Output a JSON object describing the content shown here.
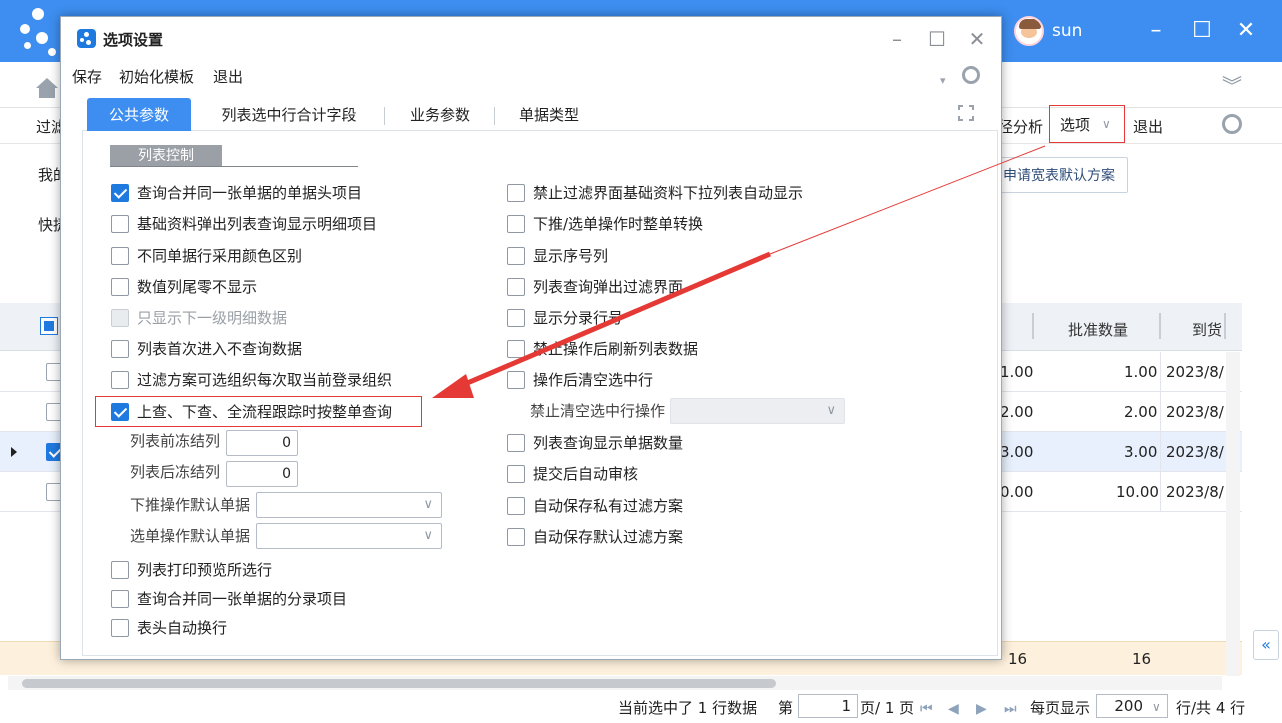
{
  "app": {
    "user_name": "sun",
    "colors": {
      "header": "#3d8ef0",
      "accent": "#1f7ae0",
      "highlight": "#e53935"
    }
  },
  "toolbar": {
    "filter_label": "过滤",
    "analysis_label": "径分析",
    "options_label": "选项",
    "exit_label": "退出"
  },
  "filter_area": {
    "my_label": "我的",
    "quick_label": "快捷",
    "scheme_button": "申请宽表默认方案"
  },
  "grid": {
    "columns": [
      "批准数量",
      "到货"
    ],
    "rows": [
      {
        "checked": false,
        "selected": false,
        "c1": "1.00",
        "c2": "1.00",
        "c3": "2023/8/"
      },
      {
        "checked": false,
        "selected": false,
        "c1": "2.00",
        "c2": "2.00",
        "c3": "2023/8/"
      },
      {
        "checked": true,
        "selected": true,
        "c1": "3.00",
        "c2": "3.00",
        "c3": "2023/8/"
      },
      {
        "checked": false,
        "selected": false,
        "c1": "0.00",
        "c2": "10.00",
        "c3": "2023/8/"
      }
    ],
    "summary": {
      "c1": "16",
      "c2": "16"
    }
  },
  "footer": {
    "selected_info": "当前选中了 1 行数据",
    "page_prefix": "第",
    "page_value": "1",
    "page_suffix": "页/ 1 页",
    "per_page_label": "每页显示",
    "per_page_value": "200",
    "rows_total": "行/共 4 行"
  },
  "dialog": {
    "title": "选项设置",
    "menu": [
      "保存",
      "初始化模板",
      "退出"
    ],
    "tabs": [
      "公共参数",
      "列表选中行合计字段",
      "业务参数",
      "单据类型"
    ],
    "group_title": "列表控制",
    "left_options": [
      {
        "label": "查询合并同一张单据的单据头项目",
        "checked": true,
        "disabled": false
      },
      {
        "label": "基础资料弹出列表查询显示明细项目",
        "checked": false,
        "disabled": false
      },
      {
        "label": "不同单据行采用颜色区别",
        "checked": false,
        "disabled": false
      },
      {
        "label": "数值列尾零不显示",
        "checked": false,
        "disabled": false
      },
      {
        "label": "只显示下一级明细数据",
        "checked": false,
        "disabled": true
      },
      {
        "label": "列表首次进入不查询数据",
        "checked": false,
        "disabled": false
      },
      {
        "label": "过滤方案可选组织每次取当前登录组织",
        "checked": false,
        "disabled": false
      },
      {
        "label": "上查、下查、全流程跟踪时按整单查询",
        "checked": true,
        "disabled": false
      }
    ],
    "left_fields": {
      "freeze_before_label": "列表前冻结列",
      "freeze_before_value": "0",
      "freeze_after_label": "列表后冻结列",
      "freeze_after_value": "0",
      "push_default_label": "下推操作默认单据",
      "select_default_label": "选单操作默认单据"
    },
    "left_options_bottom": [
      {
        "label": "列表打印预览所选行",
        "checked": false
      },
      {
        "label": "查询合并同一张单据的分录项目",
        "checked": false
      },
      {
        "label": "表头自动换行",
        "checked": false
      }
    ],
    "right_options": [
      {
        "label": "禁止过滤界面基础资料下拉列表自动显示",
        "checked": false
      },
      {
        "label": "下推/选单操作时整单转换",
        "checked": false
      },
      {
        "label": "显示序号列",
        "checked": false
      },
      {
        "label": "列表查询弹出过滤界面",
        "checked": false
      },
      {
        "label": "显示分录行号",
        "checked": false
      },
      {
        "label": "禁止操作后刷新列表数据",
        "checked": false
      },
      {
        "label": "操作后清空选中行",
        "checked": false
      }
    ],
    "right_field": {
      "label": "禁止清空选中行操作"
    },
    "right_options_bottom": [
      {
        "label": "列表查询显示单据数量",
        "checked": false
      },
      {
        "label": "提交后自动审核",
        "checked": false
      },
      {
        "label": "自动保存私有过滤方案",
        "checked": false
      },
      {
        "label": "自动保存默认过滤方案",
        "checked": false
      }
    ]
  }
}
